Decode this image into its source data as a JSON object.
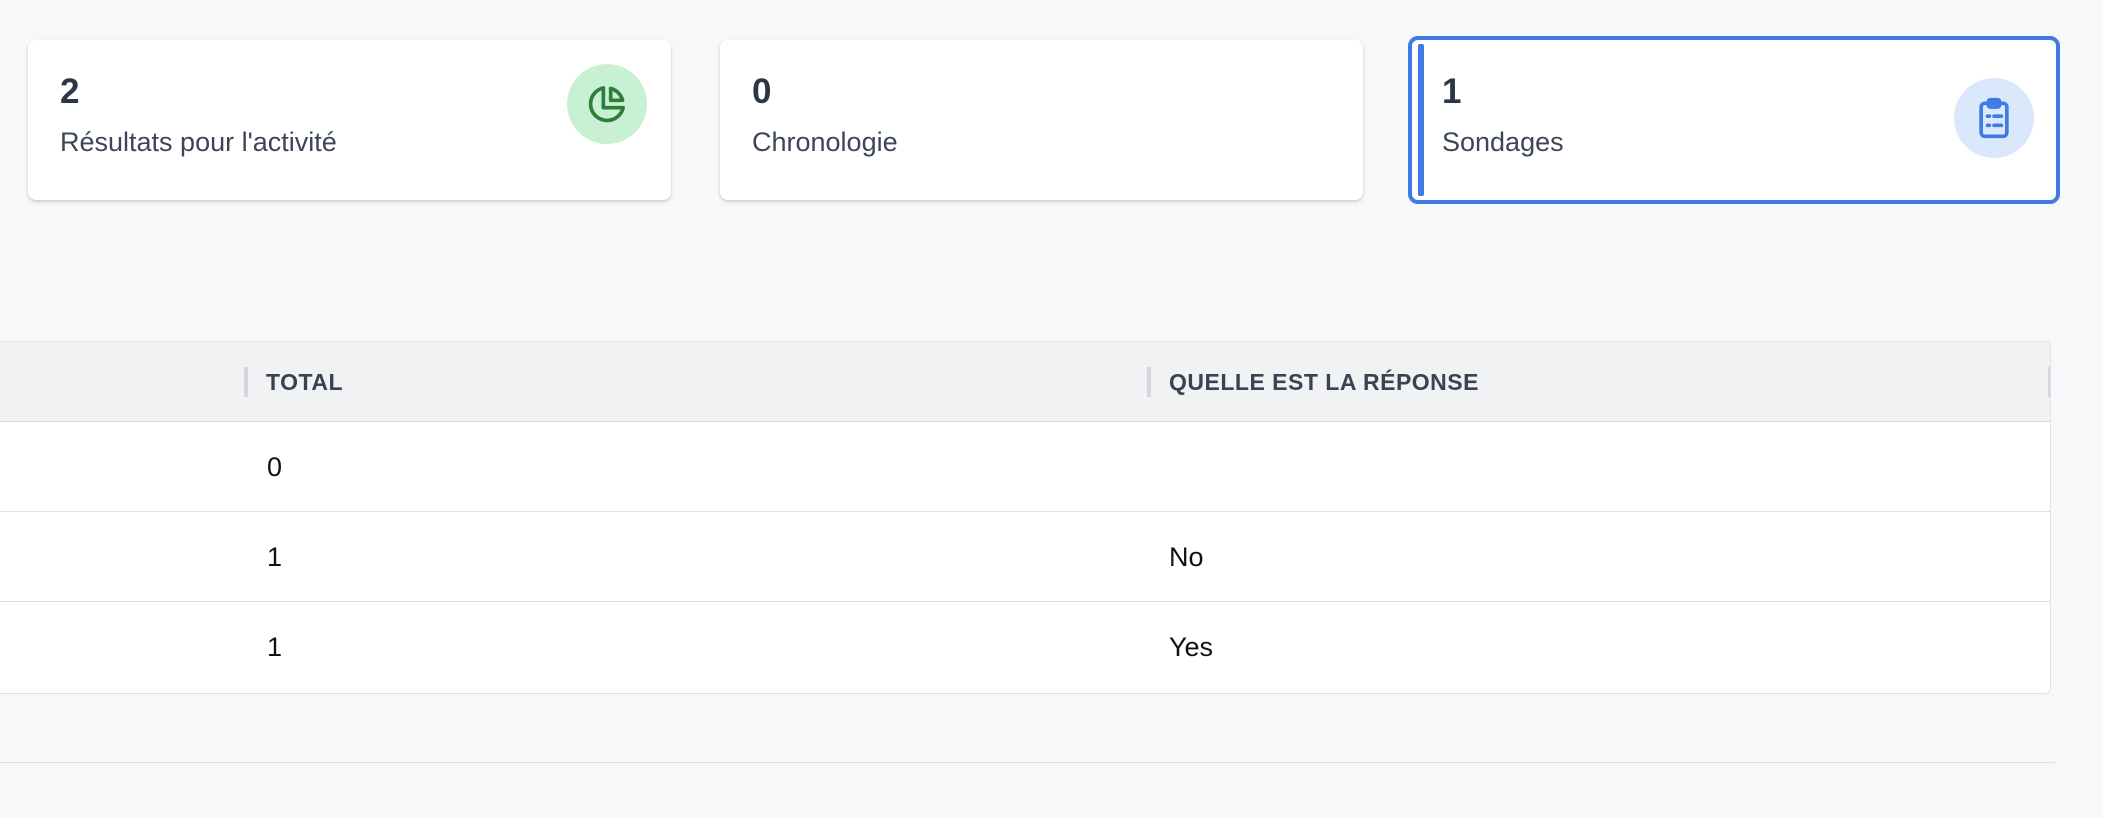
{
  "stats": [
    {
      "count": "2",
      "label": "Résultats pour l'activité",
      "icon": "pie-chart-icon",
      "icon_color": "#2e7d3b",
      "icon_bg": "#c8f1d3"
    },
    {
      "count": "0",
      "label": "Chronologie"
    },
    {
      "count": "1",
      "label": "Sondages",
      "icon": "clipboard-list-icon",
      "icon_color": "#3f7be3",
      "icon_bg": "#dbe7fb",
      "selected": true
    }
  ],
  "table": {
    "columns": [
      "TOTAL",
      "QUELLE EST LA RÉPONSE"
    ],
    "rows": [
      {
        "total": "0",
        "answer": ""
      },
      {
        "total": "1",
        "answer": "No"
      },
      {
        "total": "1",
        "answer": "Yes"
      }
    ]
  },
  "colors": {
    "accent": "#3f7be3",
    "page_bg": "#f7f8fa"
  }
}
